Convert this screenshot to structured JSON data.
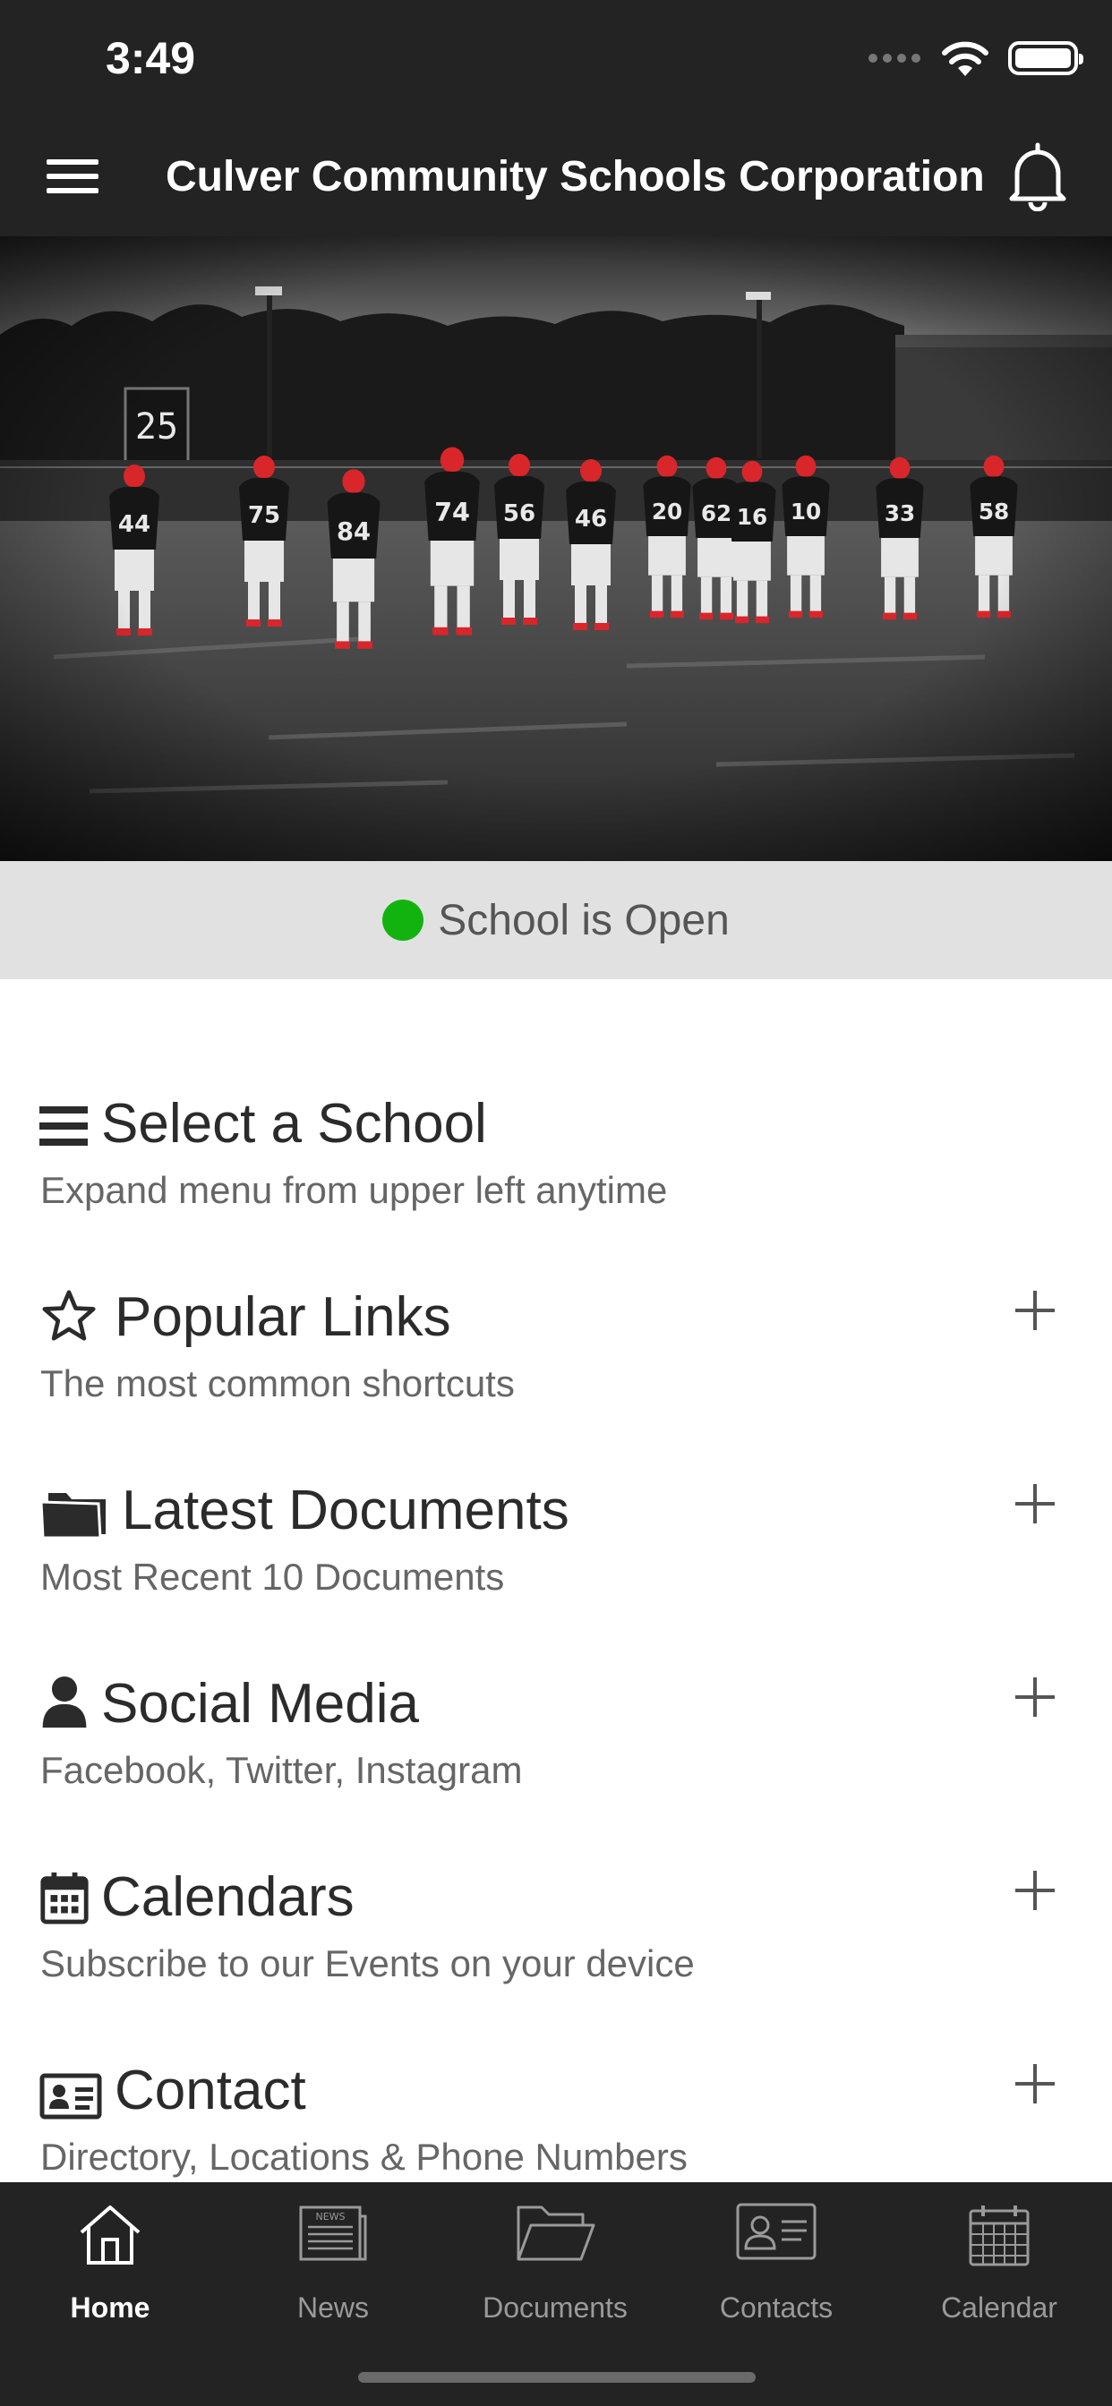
{
  "status_bar": {
    "time": "3:49"
  },
  "header": {
    "title": "Culver Community Schools Corporation"
  },
  "hero": {
    "image": "football-team-photo",
    "jersey_numbers": [
      "44",
      "75",
      "84",
      "74",
      "56",
      "46",
      "20",
      "62",
      "16",
      "10",
      "33",
      "58"
    ],
    "scoreboard": "25"
  },
  "school_status": {
    "text": "School is Open",
    "color": "#13b30f"
  },
  "sections": [
    {
      "icon": "list-icon",
      "title": "Select a School",
      "subtitle": "Expand menu from upper left anytime",
      "expandable": false
    },
    {
      "icon": "star-icon",
      "title": "Popular Links",
      "subtitle": "The most common shortcuts",
      "expandable": true
    },
    {
      "icon": "folder-icon",
      "title": "Latest Documents",
      "subtitle": "Most Recent 10 Documents",
      "expandable": true
    },
    {
      "icon": "user-icon",
      "title": "Social Media",
      "subtitle": "Facebook, Twitter, Instagram",
      "expandable": true
    },
    {
      "icon": "calendar-icon",
      "title": "Calendars",
      "subtitle": "Subscribe to our Events on your device",
      "expandable": true
    },
    {
      "icon": "contact-card-icon",
      "title": "Contact",
      "subtitle": "Directory, Locations & Phone Numbers",
      "expandable": true
    }
  ],
  "tabs": [
    {
      "label": "Home",
      "icon": "home-icon",
      "active": true
    },
    {
      "label": "News",
      "icon": "newspaper-icon",
      "active": false
    },
    {
      "label": "Documents",
      "icon": "folder-icon",
      "active": false
    },
    {
      "label": "Contacts",
      "icon": "contact-card-icon",
      "active": false
    },
    {
      "label": "Calendar",
      "icon": "calendar-icon",
      "active": false
    }
  ],
  "colors": {
    "bar_bg": "#232323",
    "banner_bg": "#e1e1e1",
    "accent_red": "#d8262b"
  }
}
